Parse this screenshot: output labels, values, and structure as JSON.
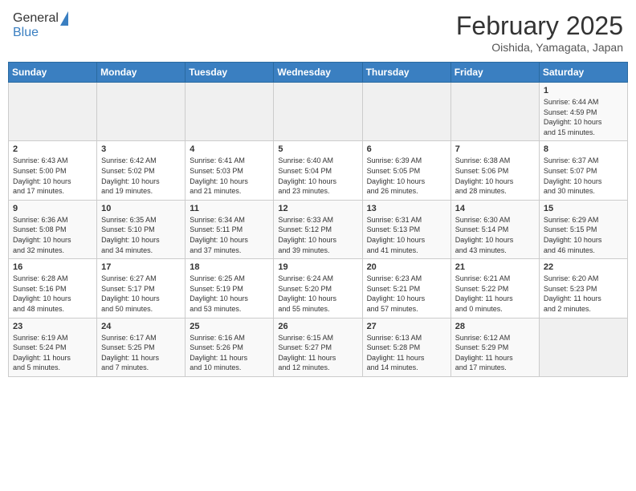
{
  "header": {
    "logo_general": "General",
    "logo_blue": "Blue",
    "month": "February 2025",
    "location": "Oishida, Yamagata, Japan"
  },
  "weekdays": [
    "Sunday",
    "Monday",
    "Tuesday",
    "Wednesday",
    "Thursday",
    "Friday",
    "Saturday"
  ],
  "weeks": [
    [
      {
        "day": "",
        "info": ""
      },
      {
        "day": "",
        "info": ""
      },
      {
        "day": "",
        "info": ""
      },
      {
        "day": "",
        "info": ""
      },
      {
        "day": "",
        "info": ""
      },
      {
        "day": "",
        "info": ""
      },
      {
        "day": "1",
        "info": "Sunrise: 6:44 AM\nSunset: 4:59 PM\nDaylight: 10 hours\nand 15 minutes."
      }
    ],
    [
      {
        "day": "2",
        "info": "Sunrise: 6:43 AM\nSunset: 5:00 PM\nDaylight: 10 hours\nand 17 minutes."
      },
      {
        "day": "3",
        "info": "Sunrise: 6:42 AM\nSunset: 5:02 PM\nDaylight: 10 hours\nand 19 minutes."
      },
      {
        "day": "4",
        "info": "Sunrise: 6:41 AM\nSunset: 5:03 PM\nDaylight: 10 hours\nand 21 minutes."
      },
      {
        "day": "5",
        "info": "Sunrise: 6:40 AM\nSunset: 5:04 PM\nDaylight: 10 hours\nand 23 minutes."
      },
      {
        "day": "6",
        "info": "Sunrise: 6:39 AM\nSunset: 5:05 PM\nDaylight: 10 hours\nand 26 minutes."
      },
      {
        "day": "7",
        "info": "Sunrise: 6:38 AM\nSunset: 5:06 PM\nDaylight: 10 hours\nand 28 minutes."
      },
      {
        "day": "8",
        "info": "Sunrise: 6:37 AM\nSunset: 5:07 PM\nDaylight: 10 hours\nand 30 minutes."
      }
    ],
    [
      {
        "day": "9",
        "info": "Sunrise: 6:36 AM\nSunset: 5:08 PM\nDaylight: 10 hours\nand 32 minutes."
      },
      {
        "day": "10",
        "info": "Sunrise: 6:35 AM\nSunset: 5:10 PM\nDaylight: 10 hours\nand 34 minutes."
      },
      {
        "day": "11",
        "info": "Sunrise: 6:34 AM\nSunset: 5:11 PM\nDaylight: 10 hours\nand 37 minutes."
      },
      {
        "day": "12",
        "info": "Sunrise: 6:33 AM\nSunset: 5:12 PM\nDaylight: 10 hours\nand 39 minutes."
      },
      {
        "day": "13",
        "info": "Sunrise: 6:31 AM\nSunset: 5:13 PM\nDaylight: 10 hours\nand 41 minutes."
      },
      {
        "day": "14",
        "info": "Sunrise: 6:30 AM\nSunset: 5:14 PM\nDaylight: 10 hours\nand 43 minutes."
      },
      {
        "day": "15",
        "info": "Sunrise: 6:29 AM\nSunset: 5:15 PM\nDaylight: 10 hours\nand 46 minutes."
      }
    ],
    [
      {
        "day": "16",
        "info": "Sunrise: 6:28 AM\nSunset: 5:16 PM\nDaylight: 10 hours\nand 48 minutes."
      },
      {
        "day": "17",
        "info": "Sunrise: 6:27 AM\nSunset: 5:17 PM\nDaylight: 10 hours\nand 50 minutes."
      },
      {
        "day": "18",
        "info": "Sunrise: 6:25 AM\nSunset: 5:19 PM\nDaylight: 10 hours\nand 53 minutes."
      },
      {
        "day": "19",
        "info": "Sunrise: 6:24 AM\nSunset: 5:20 PM\nDaylight: 10 hours\nand 55 minutes."
      },
      {
        "day": "20",
        "info": "Sunrise: 6:23 AM\nSunset: 5:21 PM\nDaylight: 10 hours\nand 57 minutes."
      },
      {
        "day": "21",
        "info": "Sunrise: 6:21 AM\nSunset: 5:22 PM\nDaylight: 11 hours\nand 0 minutes."
      },
      {
        "day": "22",
        "info": "Sunrise: 6:20 AM\nSunset: 5:23 PM\nDaylight: 11 hours\nand 2 minutes."
      }
    ],
    [
      {
        "day": "23",
        "info": "Sunrise: 6:19 AM\nSunset: 5:24 PM\nDaylight: 11 hours\nand 5 minutes."
      },
      {
        "day": "24",
        "info": "Sunrise: 6:17 AM\nSunset: 5:25 PM\nDaylight: 11 hours\nand 7 minutes."
      },
      {
        "day": "25",
        "info": "Sunrise: 6:16 AM\nSunset: 5:26 PM\nDaylight: 11 hours\nand 10 minutes."
      },
      {
        "day": "26",
        "info": "Sunrise: 6:15 AM\nSunset: 5:27 PM\nDaylight: 11 hours\nand 12 minutes."
      },
      {
        "day": "27",
        "info": "Sunrise: 6:13 AM\nSunset: 5:28 PM\nDaylight: 11 hours\nand 14 minutes."
      },
      {
        "day": "28",
        "info": "Sunrise: 6:12 AM\nSunset: 5:29 PM\nDaylight: 11 hours\nand 17 minutes."
      },
      {
        "day": "",
        "info": ""
      }
    ]
  ]
}
